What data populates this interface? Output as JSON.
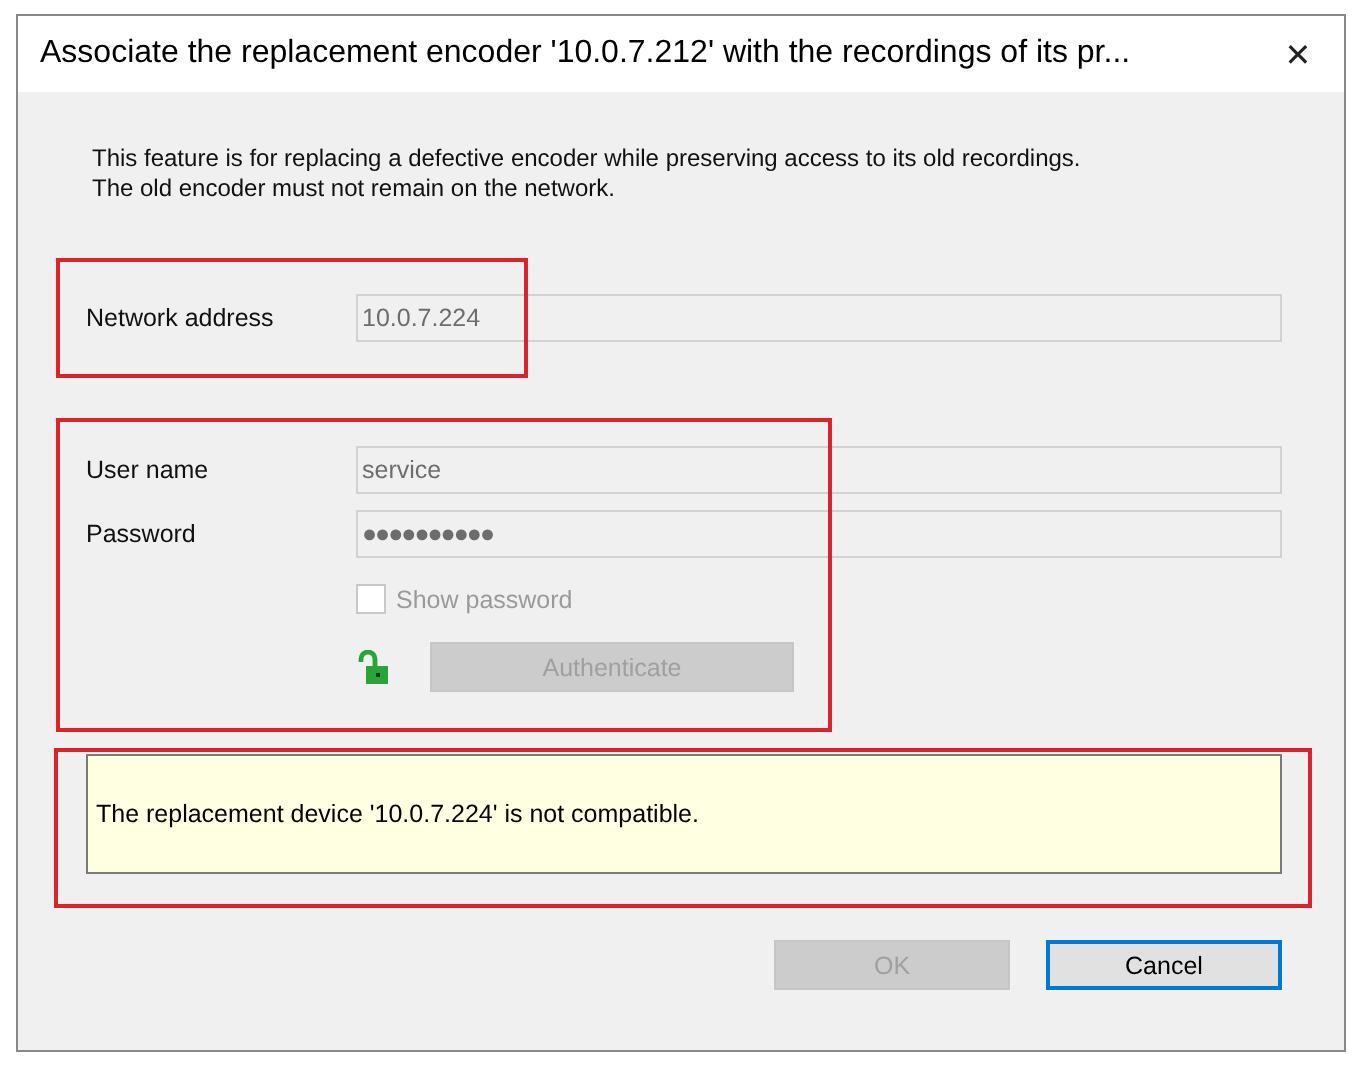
{
  "window": {
    "title": "Associate the replacement encoder '10.0.7.212' with the recordings of its pr...",
    "close": "✕"
  },
  "description": [
    "This feature is for replacing a defective encoder while preserving access to its old recordings.",
    "The old encoder must not remain on the network."
  ],
  "network_address": {
    "label": "Network address",
    "value": "10.0.7.224",
    "disabled": true
  },
  "credentials": {
    "user_name": {
      "label": "User name",
      "value": "service",
      "disabled": true
    },
    "password": {
      "label": "Password",
      "value": "●●●●●●●●●●",
      "disabled": true
    },
    "show_password": {
      "label": "Show password",
      "checked": false,
      "disabled": true
    },
    "lock": {
      "locked": false
    },
    "authenticate": {
      "label": "Authenticate",
      "disabled": true
    }
  },
  "message": "The replacement device '10.0.7.224' is not compatible.",
  "buttons": [
    {
      "label": "OK",
      "disabled": true,
      "default": false
    },
    {
      "label": "Cancel",
      "disabled": false,
      "default": true
    }
  ]
}
